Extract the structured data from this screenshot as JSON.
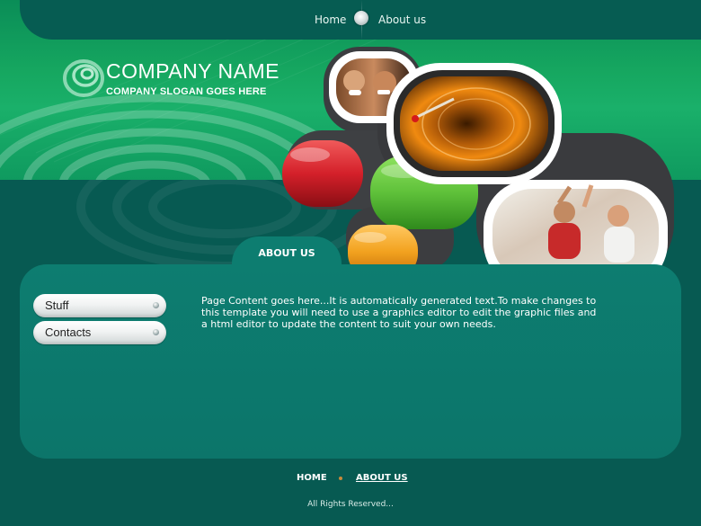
{
  "nav": {
    "home_label": "Home",
    "about_label": "About us"
  },
  "brand": {
    "company_name": "COMPANY NAME",
    "slogan": "COMPANY SLOGAN GOES HERE"
  },
  "section": {
    "tab_label": "ABOUT US",
    "body": "Page Content goes here...It is automatically generated text.To make changes to this template you will need to use a graphics editor to edit the graphic files and a html editor to update the content to suit your own needs."
  },
  "sidebar": {
    "items": [
      {
        "label": "Stuff"
      },
      {
        "label": "Contacts"
      }
    ]
  },
  "footer": {
    "home_label": "HOME",
    "about_label": "ABOUT US",
    "copyright": "All Rights Reserved..."
  },
  "colors": {
    "background": "#075a52",
    "hero_green": "#16a760",
    "panel": "#0d7d70",
    "red_pill": "#d4202a",
    "green_pill": "#5fc13a",
    "orange_pill": "#f2a21f"
  },
  "icons": {
    "logo": "concentric-ring-logo-icon",
    "nav_separator": "round-knob-icon",
    "sidebar_bullet": "dot-icon"
  }
}
